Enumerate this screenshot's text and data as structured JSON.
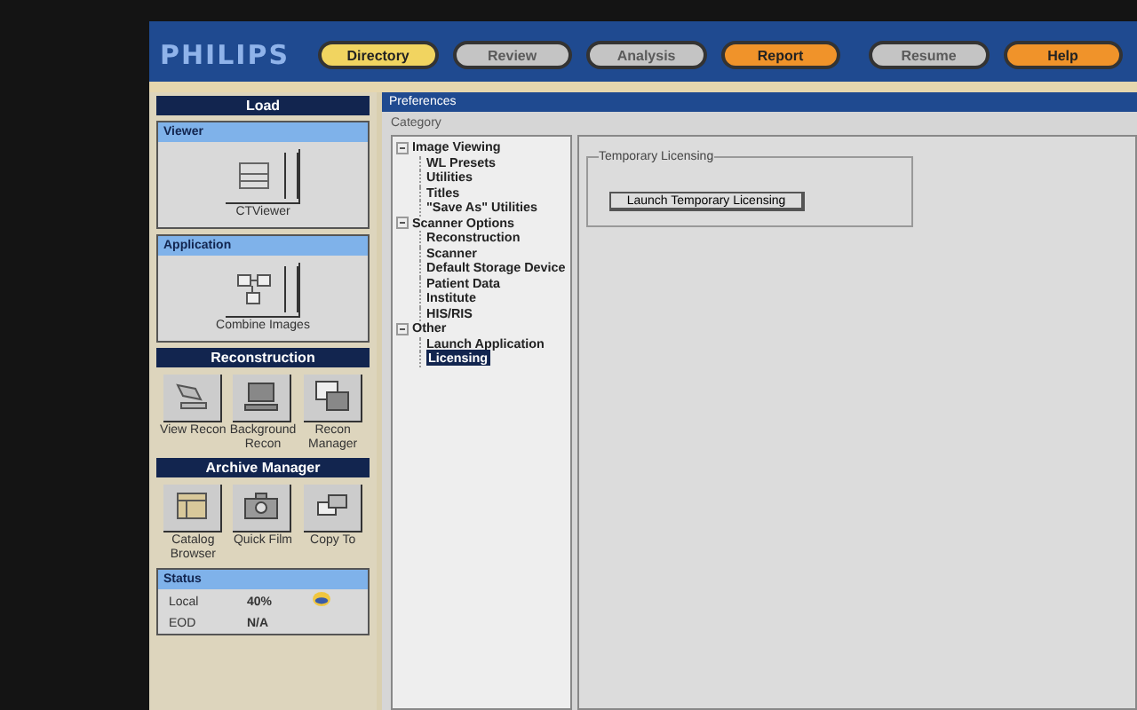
{
  "header": {
    "logo": "PHILIPS",
    "tabs": [
      {
        "label": "Directory",
        "selected": true,
        "disabled": false
      },
      {
        "label": "Review",
        "selected": false,
        "disabled": true
      },
      {
        "label": "Analysis",
        "selected": false,
        "disabled": true
      },
      {
        "label": "Report",
        "selected": false,
        "disabled": false
      }
    ],
    "right_buttons": [
      {
        "label": "Resume",
        "disabled": true
      },
      {
        "label": "Help",
        "disabled": false
      }
    ]
  },
  "sidebar": {
    "title": "Load",
    "sections": [
      {
        "kind": "single",
        "title": "Viewer",
        "tools": [
          {
            "label": "CTViewer"
          }
        ]
      },
      {
        "kind": "single",
        "title": "Application",
        "tools": [
          {
            "label": "Combine Images"
          }
        ]
      },
      {
        "kind": "grid",
        "title": "Reconstruction",
        "tools": [
          {
            "label": "View Recon"
          },
          {
            "label": "Background Recon"
          },
          {
            "label": "Recon Manager"
          }
        ]
      },
      {
        "kind": "grid",
        "title": "Archive Manager",
        "tools": [
          {
            "label": "Catalog Browser"
          },
          {
            "label": "Quick Film"
          },
          {
            "label": "Copy To"
          }
        ]
      }
    ],
    "status": {
      "title": "Status",
      "rows": [
        {
          "label": "Local",
          "value": "40%"
        },
        {
          "label": "EOD",
          "value": "N/A"
        }
      ]
    }
  },
  "preferences": {
    "title": "Preferences",
    "category_label": "Category",
    "tree": [
      {
        "label": "Image Viewing",
        "expanded": true,
        "selected": false,
        "children": [
          {
            "label": "WL Presets",
            "selected": false
          },
          {
            "label": "Utilities",
            "selected": false
          },
          {
            "label": "Titles",
            "selected": false
          },
          {
            "label": "\"Save As\" Utilities",
            "selected": false
          }
        ]
      },
      {
        "label": "Scanner Options",
        "expanded": true,
        "selected": false,
        "children": [
          {
            "label": "Reconstruction",
            "selected": false
          },
          {
            "label": "Scanner",
            "selected": false
          },
          {
            "label": "Default Storage Device",
            "selected": false
          },
          {
            "label": "Patient Data",
            "selected": false
          },
          {
            "label": "Institute",
            "selected": false
          },
          {
            "label": "HIS/RIS",
            "selected": false
          }
        ]
      },
      {
        "label": "Other",
        "expanded": true,
        "selected": false,
        "children": [
          {
            "label": "Launch Application",
            "selected": false
          },
          {
            "label": "Licensing",
            "selected": true
          }
        ]
      }
    ],
    "group_title": "Temporary Licensing",
    "button": "Launch Temporary Licensing"
  }
}
